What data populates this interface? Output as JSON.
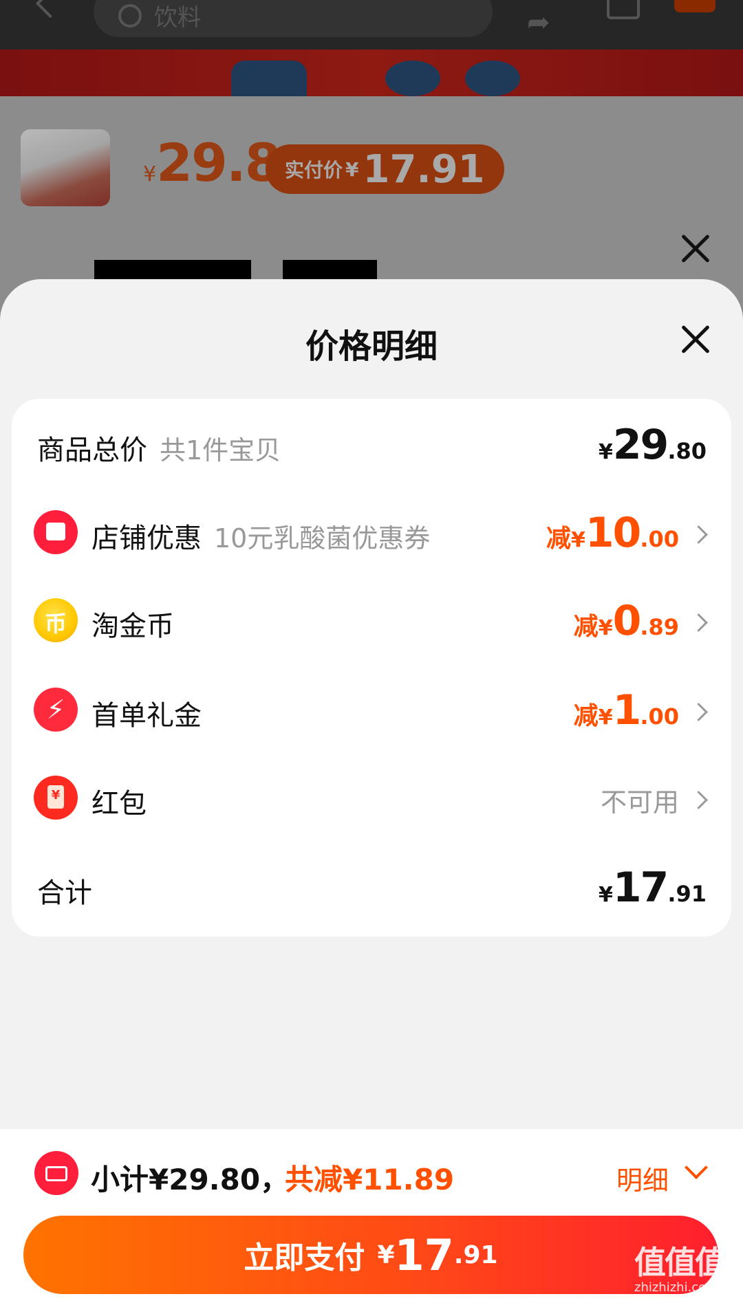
{
  "background": {
    "search_placeholder": "饮料",
    "product_price_currency": "¥",
    "product_price": "29.8",
    "badge_label": "实付价",
    "badge_currency": "¥",
    "badge_value": "17.91"
  },
  "sheet": {
    "title": "价格明细"
  },
  "rows": [
    {
      "label": "商品总价",
      "sub": "共1件宝贝",
      "prefix": "",
      "currency": "¥",
      "int": "29",
      "dec": ".80",
      "icon": ""
    },
    {
      "label": "店铺优惠",
      "sub": "10元乳酸菌优惠券",
      "prefix": "减",
      "currency": "¥",
      "int": "10",
      "dec": ".00",
      "icon": "store-icon"
    },
    {
      "label": "淘金币",
      "sub": "",
      "prefix": "减",
      "currency": "¥",
      "int": "0",
      "dec": ".89",
      "icon": "coin-icon",
      "icon_glyph": "币"
    },
    {
      "label": "首单礼金",
      "sub": "",
      "prefix": "减",
      "currency": "¥",
      "int": "1",
      "dec": ".00",
      "icon": "lightning-icon",
      "icon_glyph": "⚡"
    },
    {
      "label": "红包",
      "sub": "",
      "status": "不可用",
      "icon": "red-packet-icon",
      "icon_glyph": "¥"
    },
    {
      "label": "合计",
      "sub": "",
      "prefix": "",
      "currency": "¥",
      "int": "17",
      "dec": ".91",
      "icon": ""
    }
  ],
  "bottom": {
    "subtotal": "小计¥29.80，",
    "discount": "共减¥11.89",
    "detail_label": "明细",
    "pay_label": "立即支付",
    "pay_currency": "¥",
    "pay_int": "17",
    "pay_dec": ".91"
  },
  "watermark": {
    "logo": "值值值",
    "url": "zhizhizhi.com"
  },
  "colors": {
    "accent": "#ff5000",
    "brand_red": "#ff1f3d",
    "pay_gradient_start": "#ff7300",
    "pay_gradient_end": "#ff1f2e"
  }
}
